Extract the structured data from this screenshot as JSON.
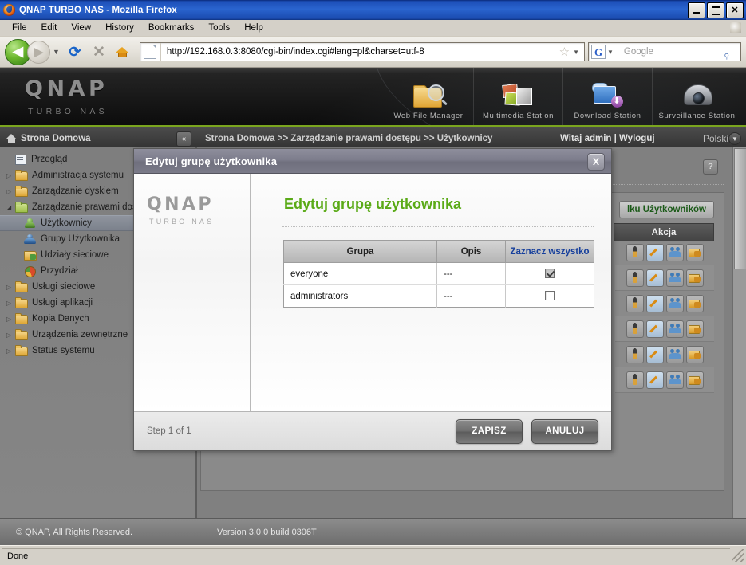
{
  "window": {
    "title": "QNAP TURBO NAS - Mozilla Firefox",
    "minimize_label": "_",
    "maximize_label": "□",
    "close_label": "✕"
  },
  "menubar": {
    "items": [
      "File",
      "Edit",
      "View",
      "History",
      "Bookmarks",
      "Tools",
      "Help"
    ]
  },
  "toolbar": {
    "back_label": "◀",
    "forward_label": "▶",
    "dropdown_label": "▼",
    "reload_label": "⟳",
    "stop_label": "✕",
    "home_label": "home-icon",
    "url": "http://192.168.0.3:8080/cgi-bin/index.cgi#lang=pl&charset=utf-8",
    "bookmark_star": "☆",
    "bookmark_caret": "▼",
    "search_engine": "G",
    "search_caret": "▼",
    "search_placeholder": "Google",
    "search_icon": "⌕"
  },
  "banner": {
    "logo_word": "QNAP",
    "logo_sub": "TURBO NAS",
    "apps": [
      {
        "label": "Web File Manager",
        "icon": "folder-search-icon"
      },
      {
        "label": "Multimedia Station",
        "icon": "media-photos-icon"
      },
      {
        "label": "Download Station",
        "icon": "download-monitor-icon"
      },
      {
        "label": "Surveillance Station",
        "icon": "dome-camera-icon"
      }
    ]
  },
  "crumbbar": {
    "home_label": "Strona Domowa",
    "collapse_label": "«",
    "path": "Strona Domowa >> Zarządzanie prawami dostępu >> Użytkownicy",
    "welcome": "Witaj admin | Wyloguj",
    "language": "Polski",
    "language_caret": "▼"
  },
  "sidebar": {
    "items": [
      {
        "label": "Przegląd",
        "level": 1,
        "icon": "doc",
        "arrow": "",
        "selected": false
      },
      {
        "label": "Administracja systemu",
        "level": 1,
        "icon": "folder",
        "arrow": "▷",
        "selected": false
      },
      {
        "label": "Zarządzanie dyskiem",
        "level": 1,
        "icon": "folder",
        "arrow": "▷",
        "selected": false
      },
      {
        "label": "Zarządzanie prawami dostępu",
        "level": 1,
        "icon": "folderopen",
        "arrow": "◢",
        "selected": false
      },
      {
        "label": "Użytkownicy",
        "level": 2,
        "icon": "user1",
        "arrow": "",
        "selected": true
      },
      {
        "label": "Grupy Użytkownika",
        "level": 2,
        "icon": "user2",
        "arrow": "",
        "selected": false
      },
      {
        "label": "Udziały sieciowe",
        "level": 2,
        "icon": "share",
        "arrow": "",
        "selected": false
      },
      {
        "label": "Przydział",
        "level": 2,
        "icon": "quota",
        "arrow": "",
        "selected": false
      },
      {
        "label": "Usługi sieciowe",
        "level": 1,
        "icon": "folder",
        "arrow": "▷",
        "selected": false
      },
      {
        "label": "Usługi aplikacji",
        "level": 1,
        "icon": "folder",
        "arrow": "▷",
        "selected": false
      },
      {
        "label": "Kopia Danych",
        "level": 1,
        "icon": "folder",
        "arrow": "▷",
        "selected": false
      },
      {
        "label": "Urządzenia zewnętrzne",
        "level": 1,
        "icon": "folder",
        "arrow": "▷",
        "selected": false
      },
      {
        "label": "Status systemu",
        "level": 1,
        "icon": "folder",
        "arrow": "▷",
        "selected": false
      }
    ]
  },
  "content": {
    "help_label": "?",
    "create_button": "lku Użytkowników",
    "action_column_header": "Akcja",
    "action_icons": [
      "key-icon",
      "edit-pencil-icon",
      "user-group-icon",
      "shared-folder-icon"
    ],
    "action_row_count": 6
  },
  "dialog": {
    "titlebar": "Edytuj grupę użytkownika",
    "close_label": "X",
    "logo_word": "QNAP",
    "logo_sub": "TURBO NAS",
    "heading": "Edytuj grupę użytkownika",
    "table": {
      "headers": [
        "Grupa",
        "Opis",
        "Zaznacz wszystko"
      ],
      "rows": [
        {
          "group": "everyone",
          "description": "---",
          "checked": true
        },
        {
          "group": "administrators",
          "description": "---",
          "checked": false
        }
      ]
    },
    "step_label": "Step 1 of 1",
    "save_label": "ZAPISZ",
    "cancel_label": "ANULUJ"
  },
  "pagefooter": {
    "copyright": "© QNAP, All Rights Reserved.",
    "version": "Version 3.0.0 build 0306T"
  },
  "statusbar": {
    "text": "Done"
  },
  "colors": {
    "accent_green": "#5aaa17",
    "banner_dark": "#171717",
    "select_all_blue": "#163f9c",
    "titlebar_blue": "#2a64cf"
  }
}
